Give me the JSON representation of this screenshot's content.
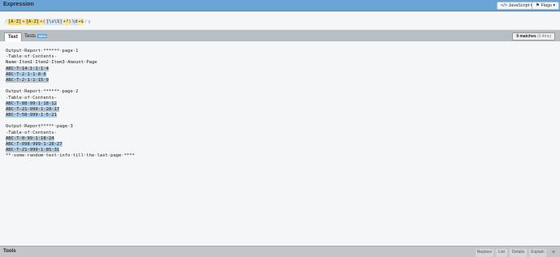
{
  "expression_panel": {
    "title": "Expression",
    "language_button": "</> JavaScript ▾",
    "flags_button": "⚑ Flags ▾",
    "regex": {
      "open": "/",
      "set1": "[A-Z]",
      "set2": "[A-Z]",
      "group1": "+(",
      "esc": "[\\s\\S]",
      "lazy": "+?)",
      "digits": "\\d",
      "tail": "+$",
      "close": "/",
      "flags": "g"
    }
  },
  "text_panel": {
    "tabs": [
      {
        "label": "Text"
      },
      {
        "label": "Tests",
        "badge": "NEW"
      }
    ],
    "match_count": "9 matches",
    "match_time": "(0.4ms)",
    "lines": [
      "Output·Report·******·page·1",
      "-Table·of·Contents-",
      "Name·Item1·Item2·Item3·Amount·Page",
      "ABC·T-14·1·1·1·4",
      "ABC·T-2·1·1·8·8",
      "ABC·T-2·1·1·15·9",
      "",
      "Output·Report·******·page·2",
      "-Table·of·Contents-",
      "ABC·T-88·99·1·18·12",
      "ABC·T-21·999·1·28·17",
      "ABC·T-58·999·1·5·21",
      "",
      "Output·Report*****·page·3",
      "-Table·of·Contents-",
      "ABC·T-8·99·1·18·24",
      "ABC·T-098·999·1·28·27",
      "ABC·T-21·999·1·85·31",
      "**·some·random·text·info·till·the·last·page·****"
    ]
  },
  "tools_panel": {
    "title": "Tools",
    "tabs": [
      "Replace",
      "List",
      "Details",
      "Explain"
    ],
    "add_label": "+"
  },
  "colors": {
    "header_blue": "#6ba5d8",
    "match_highlight": "#a8cdee",
    "set_highlight": "#f6de7e"
  }
}
